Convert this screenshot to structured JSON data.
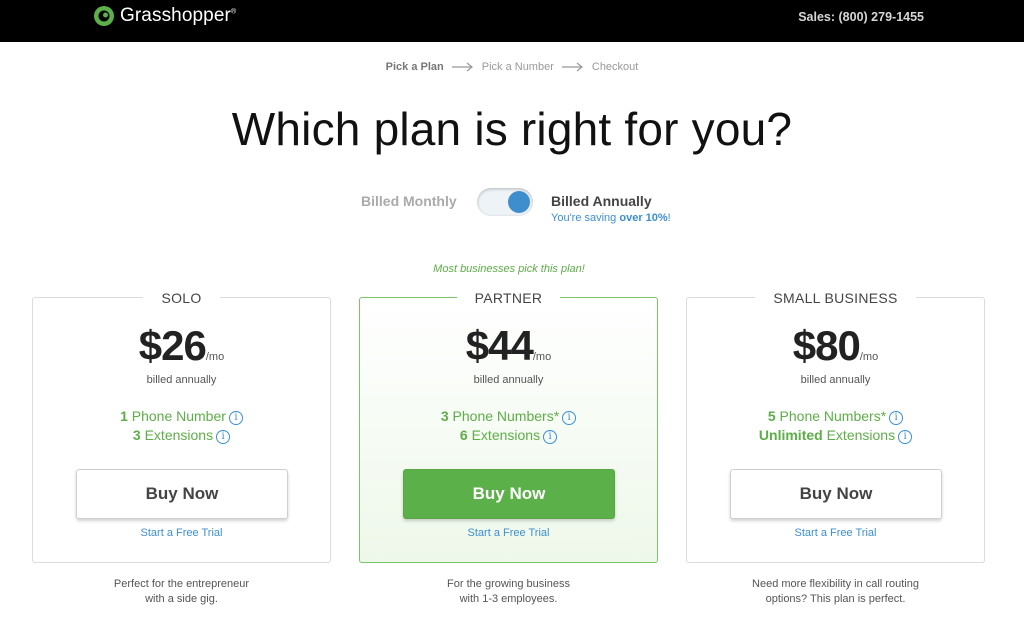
{
  "header": {
    "logo_text": "Grasshopper",
    "logo_tm": "®",
    "sales": "Sales: (800) 279-1455"
  },
  "steps": [
    "Pick a Plan",
    "Pick a Number",
    "Checkout"
  ],
  "headline": "Which plan is right for you?",
  "billing": {
    "monthly_label": "Billed Monthly",
    "annual_label": "Billed Annually",
    "saving_prefix": "You're saving ",
    "saving_amount": "over 10%",
    "saving_suffix": "!",
    "selected": "annual"
  },
  "featured_note": "Most businesses pick this plan!",
  "plans": [
    {
      "name": "SOLO",
      "price": "$26",
      "per": "/mo",
      "billed": "billed annually",
      "f1_count": "1",
      "f1_label": " Phone Number",
      "f2_count": "3",
      "f2_label": " Extensions",
      "button": "Buy Now",
      "trial": "Start a Free Trial",
      "desc_line1": "Perfect for the entrepreneur",
      "desc_line2": "with a side gig."
    },
    {
      "name": "PARTNER",
      "price": "$44",
      "per": "/mo",
      "billed": "billed annually",
      "f1_count": "3",
      "f1_label": " Phone Numbers*",
      "f2_count": "6",
      "f2_label": " Extensions",
      "button": "Buy Now",
      "trial": "Start a Free Trial",
      "desc_line1": "For the growing business",
      "desc_line2": "with 1-3 employees."
    },
    {
      "name": "SMALL BUSINESS",
      "price": "$80",
      "per": "/mo",
      "billed": "billed annually",
      "f1_count": "5",
      "f1_label": " Phone Numbers*",
      "f2_count": "Unlimited",
      "f2_label": " Extensions",
      "button": "Buy Now",
      "trial": "Start a Free Trial",
      "desc_line1": "Need more flexibility in call routing",
      "desc_line2": "options? This plan is perfect."
    }
  ],
  "icons": {
    "info": "info-icon",
    "arrow": "arrow-right-icon",
    "logo": "grasshopper-logo-icon"
  },
  "colors": {
    "brand_green": "#5cb04a",
    "link_blue": "#3c8fd1",
    "toggle_knob": "#3e8ecd"
  }
}
